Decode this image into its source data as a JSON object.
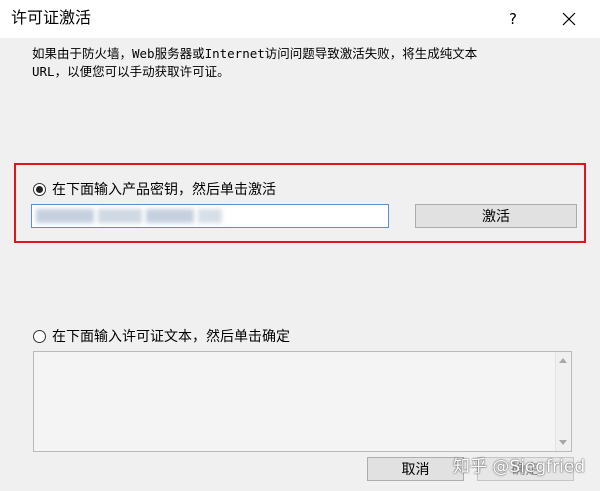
{
  "window": {
    "title": "许可证激活",
    "help_label": "?",
    "close_icon": "close-icon"
  },
  "description": {
    "line1": "如果由于防火墙，Web服务器或Internet访问问题导致激活失败，将生成纯文本",
    "line2": "URL，以便您可以手动获取许可证。"
  },
  "product_key_option": {
    "label": "在下面输入产品密钥，然后单击激活",
    "selected": true,
    "input_value": "",
    "activate_label": "激活"
  },
  "license_text_option": {
    "label": "在下面输入许可证文本，然后单击确定",
    "selected": false,
    "text_value": ""
  },
  "footer": {
    "cancel_label": "取消",
    "ok_label": "确定"
  },
  "watermark": "知乎 @Siegfried",
  "colors": {
    "highlight_border": "#e0161b",
    "input_focus_border": "#5a8fd6"
  }
}
